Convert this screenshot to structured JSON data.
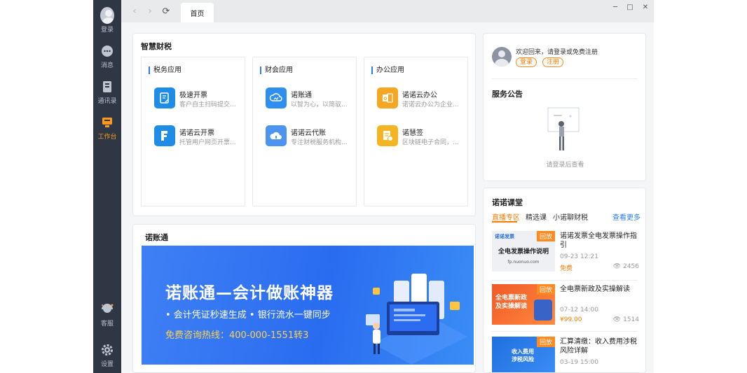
{
  "sidebar": {
    "items": [
      {
        "label": "登录",
        "icon": "user-avatar-icon"
      },
      {
        "label": "消息",
        "icon": "chat-bubble-icon"
      },
      {
        "label": "通讯录",
        "icon": "contacts-book-icon"
      },
      {
        "label": "工作台",
        "icon": "workbench-icon",
        "active": true
      },
      {
        "label": "客服",
        "icon": "headset-icon"
      },
      {
        "label": "设置",
        "icon": "gear-icon"
      }
    ]
  },
  "titlebar": {
    "tab_label": "首页",
    "back_icon": "chevron-left-icon",
    "forward_icon": "chevron-right-icon",
    "refresh_icon": "refresh-icon",
    "minimize_icon": "minimize-icon",
    "maximize_icon": "maximize-icon",
    "close_icon": "close-icon"
  },
  "smart_tax": {
    "title": "智慧财税",
    "columns": [
      {
        "title": "税务应用",
        "apps": [
          {
            "name": "极速开票",
            "desc": "客户自主扫码提交...",
            "icon": "invoice-icon",
            "color": "#1f8ce6"
          },
          {
            "name": "诺诺云开票",
            "desc": "托管用户网页开票...",
            "icon": "cloud-invoice-icon",
            "color": "#1f8ce6"
          }
        ]
      },
      {
        "title": "财会应用",
        "apps": [
          {
            "name": "诺账通",
            "desc": "以智为心，以简驭...",
            "icon": "cloud-ledger-icon",
            "color": "#2f8ff0"
          },
          {
            "name": "诺诺云代账",
            "desc": "专注财税服务机构...",
            "icon": "cloud-bookkeeping-icon",
            "color": "#4d93f0"
          }
        ]
      },
      {
        "title": "办公应用",
        "apps": [
          {
            "name": "诺诺云办公",
            "desc": "诺诺云办公为企业...",
            "icon": "office-icon",
            "color": "#f5a623"
          },
          {
            "name": "诺慧签",
            "desc": "区块链电子合同，...",
            "icon": "e-sign-icon",
            "color": "#f5b523"
          }
        ]
      }
    ]
  },
  "nuozhangtong": {
    "title": "诺账通",
    "banner": {
      "headline": "诺账通—会计做账神器",
      "features": "• 会计凭证秒速生成    • 银行流水一键同步",
      "hotline": "免费咨询热线：400-000-1551转3"
    }
  },
  "user_panel": {
    "welcome": "欢迎回来，请登录或免费注册",
    "login_label": "登录",
    "register_label": "注册"
  },
  "announcement": {
    "title": "服务公告",
    "empty_text": "请登录后查看"
  },
  "courses": {
    "title": "诺诺课堂",
    "tabs": [
      "直播专区",
      "精选课",
      "小诺聊财税"
    ],
    "more_label": "查看更多",
    "items": [
      {
        "title": "诺诺发票全电发票操作指引",
        "date": "09-23 12:21",
        "price": "免费",
        "views": "2456",
        "badge": "回放",
        "thumb_text": "全电发票操作说明",
        "thumb_brand": "诺诺发票",
        "thumb_url": "fp.nuonuo.com"
      },
      {
        "title": "全电票新政及实操解读",
        "date": "07-12 14:00",
        "price": "¥99.00",
        "views": "1514",
        "badge": "回放",
        "thumb_text": "全电票新政\n及实操解读"
      },
      {
        "title": "汇算清缴：收入费用涉税风险详解",
        "date": "03-19 15:00",
        "price": "",
        "views": "",
        "badge": "回放",
        "thumb_text": "收入费用\n涉税风险"
      }
    ]
  }
}
